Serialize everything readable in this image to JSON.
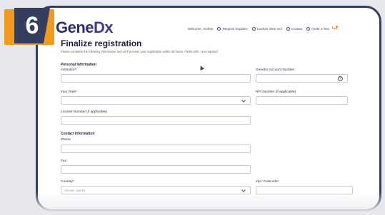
{
  "step": {
    "number": "6"
  },
  "logo": {
    "text_main": "Gene",
    "text_dx": "Dx"
  },
  "topnav": {
    "welcome": "Welcome, Andrea",
    "request_supplies": "Request Supplies",
    "custom_slice": "Custom Slice tool",
    "contact": "Contact",
    "order_test": "Order a Test"
  },
  "page": {
    "title": "Finalize registration",
    "subtitle": "Please complete the following information and we'll process your registration within 48 hours. Fields with * are required"
  },
  "sections": {
    "personal": "Personal Information",
    "contact": "Contact Information"
  },
  "fields": {
    "institution": {
      "label": "Institution*",
      "value": ""
    },
    "account_number": {
      "label": "GeneDx Account Number",
      "value": ""
    },
    "role": {
      "label": "Your Role*",
      "value": ""
    },
    "npi": {
      "label": "NPI Number (if applicable)",
      "value": ""
    },
    "license": {
      "label": "License Number (if applicable)",
      "value": ""
    },
    "phone": {
      "label": "Phone",
      "value": ""
    },
    "fax": {
      "label": "Fax",
      "value": ""
    },
    "country": {
      "label": "Country*",
      "placeholder": "Choose country"
    },
    "zip": {
      "label": "Zip / Postcode*",
      "value": ""
    }
  },
  "colors": {
    "badge_orange": "#f39a1c",
    "badge_navy": "#353e5e",
    "brand": "#2d2f6f"
  }
}
